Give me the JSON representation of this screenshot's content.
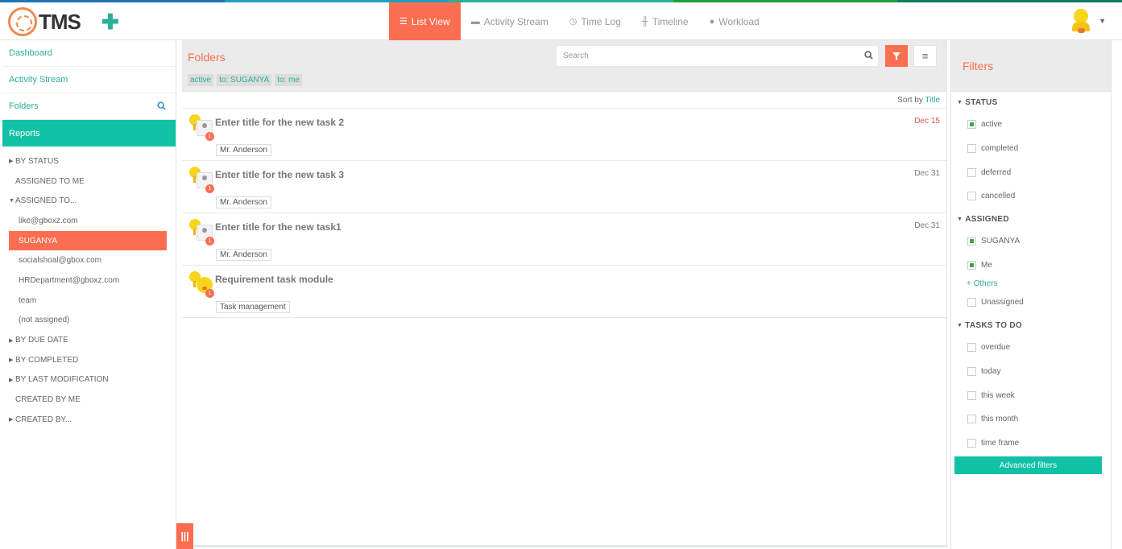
{
  "colors": {
    "accent": "#fc6e51",
    "teal": "#11c1a5",
    "link": "#2ab09a",
    "stripe": [
      "#1f74b7",
      "#1fa0c0",
      "#2ab09a",
      "#1e9e40",
      "#0e7c5f"
    ]
  },
  "app": {
    "logo_text": "TMS",
    "add_icon": "plus-icon"
  },
  "nav": {
    "tabs": [
      {
        "label": "List View",
        "icon": "list-icon",
        "active": true
      },
      {
        "label": "Activity Stream",
        "icon": "comment-icon"
      },
      {
        "label": "Time Log",
        "icon": "clock-icon"
      },
      {
        "label": "Timeline",
        "icon": "timeline-icon"
      },
      {
        "label": "Workload",
        "icon": "user-icon"
      }
    ]
  },
  "sidebar": {
    "links": [
      {
        "label": "Dashboard"
      },
      {
        "label": "Activity Stream"
      },
      {
        "label": "Folders"
      },
      {
        "label": "Reports"
      }
    ],
    "tree": [
      {
        "label": "BY STATUS"
      },
      {
        "label": "ASSIGNED TO ME"
      },
      {
        "label": "ASSIGNED TO..."
      },
      {
        "label": "like@gboxz.com"
      },
      {
        "label": "SUGANYA"
      },
      {
        "label": "socialshoal@gbox.com"
      },
      {
        "label": "HRDepartment@gboxz.com"
      },
      {
        "label": "team"
      },
      {
        "label": "(not assigned)"
      },
      {
        "label": "BY DUE DATE"
      },
      {
        "label": "BY COMPLETED"
      },
      {
        "label": "BY LAST MODIFICATION"
      },
      {
        "label": "CREATED BY ME"
      },
      {
        "label": "CREATED BY..."
      }
    ]
  },
  "main": {
    "title": "Folders",
    "tags": [
      "active",
      "to: SUGANYA",
      "to: me"
    ],
    "search_placeholder": "Search",
    "sort_label": "Sort by",
    "sort_value": "Title",
    "tasks": [
      {
        "title": "Enter title for the new task 2",
        "date": "Dec 15",
        "folder": "Mr. Anderson",
        "badge": "1"
      },
      {
        "title": "Enter title for the new task 3",
        "date": "Dec 31",
        "folder": "Mr. Anderson",
        "badge": "1"
      },
      {
        "title": "Enter title for the new task1",
        "date": "Dec 31",
        "folder": "Mr. Anderson",
        "badge": "1"
      },
      {
        "title": "Requirement task module",
        "date": "",
        "folder": "Task management",
        "badge": "1"
      }
    ]
  },
  "filters": {
    "title": "Filters",
    "status": {
      "label": "STATUS",
      "options": [
        "active",
        "completed",
        "deferred",
        "cancelled"
      ]
    },
    "assigned": {
      "label": "ASSIGNED",
      "options": [
        "SUGANYA",
        "Me"
      ],
      "others_label": "+ Others",
      "unassigned": "Unassigned"
    },
    "todo": {
      "label": "TASKS TO DO",
      "options": [
        "overdue",
        "today",
        "this week",
        "this month",
        "time frame"
      ]
    },
    "advanced_label": "Advanced filters"
  }
}
